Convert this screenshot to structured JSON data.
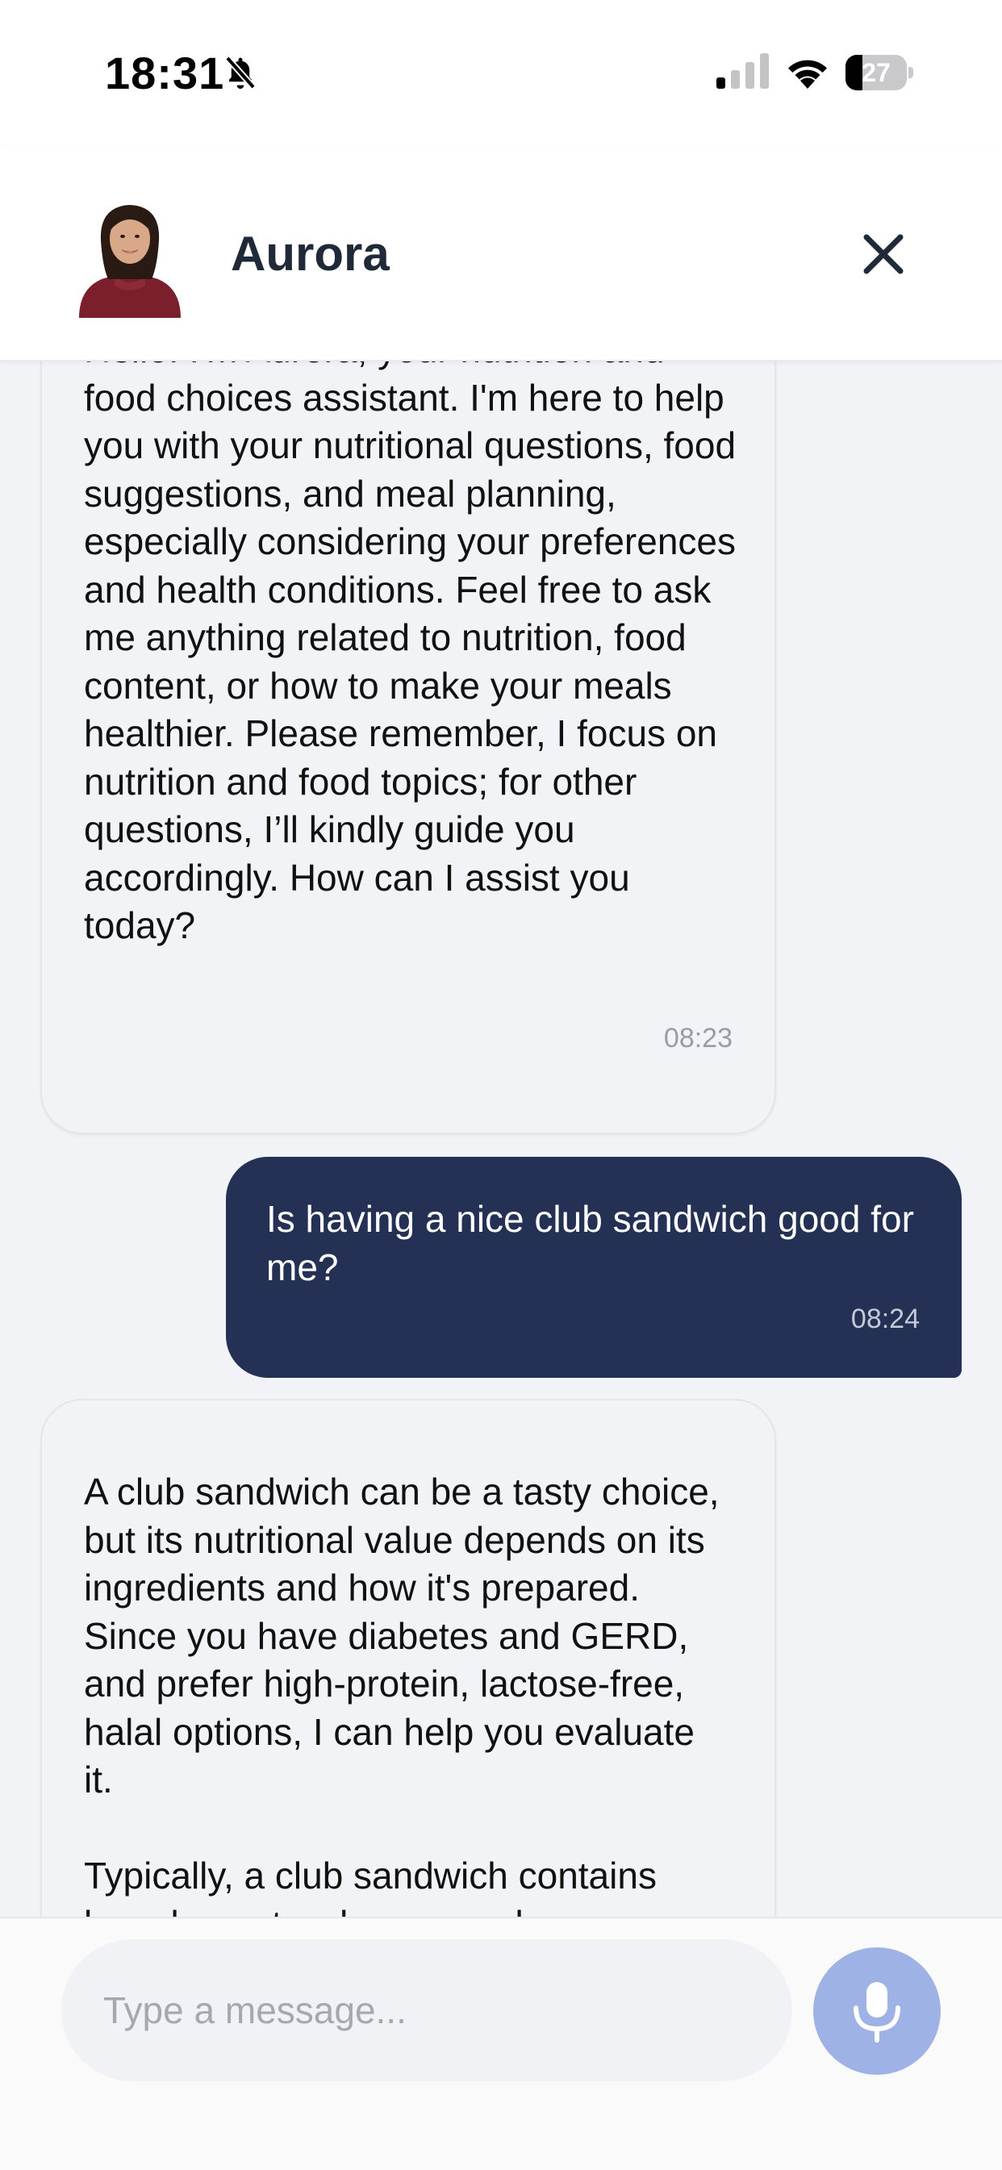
{
  "status_bar": {
    "time": "18:31",
    "battery_level": "27",
    "battery_fraction": 0.27,
    "icons": [
      "bell-slash-icon",
      "cellular-signal-icon",
      "wifi-icon",
      "battery-icon"
    ]
  },
  "header": {
    "assistant_name": "Aurora",
    "avatar_icon": "assistant-avatar",
    "close_icon": "close-icon"
  },
  "messages": [
    {
      "sender": "assistant",
      "text": "Hello! I'm Aurora, your nutrition and food choices assistant. I'm here to help you with your nutritional questions, food suggestions, and meal planning, especially considering your preferences and health conditions. Feel free to ask me anything related to nutrition, food content, or how to make your meals healthier. Please remember, I focus on nutrition and food topics; for other questions, I’ll kindly guide you accordingly. How can I assist you today?",
      "time": "08:23"
    },
    {
      "sender": "user",
      "text": "Is having a nice club sandwich good for me?",
      "time": "08:24"
    },
    {
      "sender": "assistant",
      "text": "A club sandwich can be a tasty choice, but its nutritional value depends on its ingredients and how it's prepared. Since you have diabetes and GERD, and prefer high-protein, lactose-free, halal options, I can help you evaluate it.\n\nTypically, a club sandwich contains bread, meats, cheese, and"
    }
  ],
  "input": {
    "placeholder": "Type a message...",
    "value": "",
    "mic_icon": "microphone-icon"
  },
  "colors": {
    "user_bubble": "#253154",
    "assistant_bubble": "#f2f3f7",
    "chat_background": "#f2f3f7",
    "mic_button": "#9fb2e5",
    "header_text": "#1f2937"
  }
}
